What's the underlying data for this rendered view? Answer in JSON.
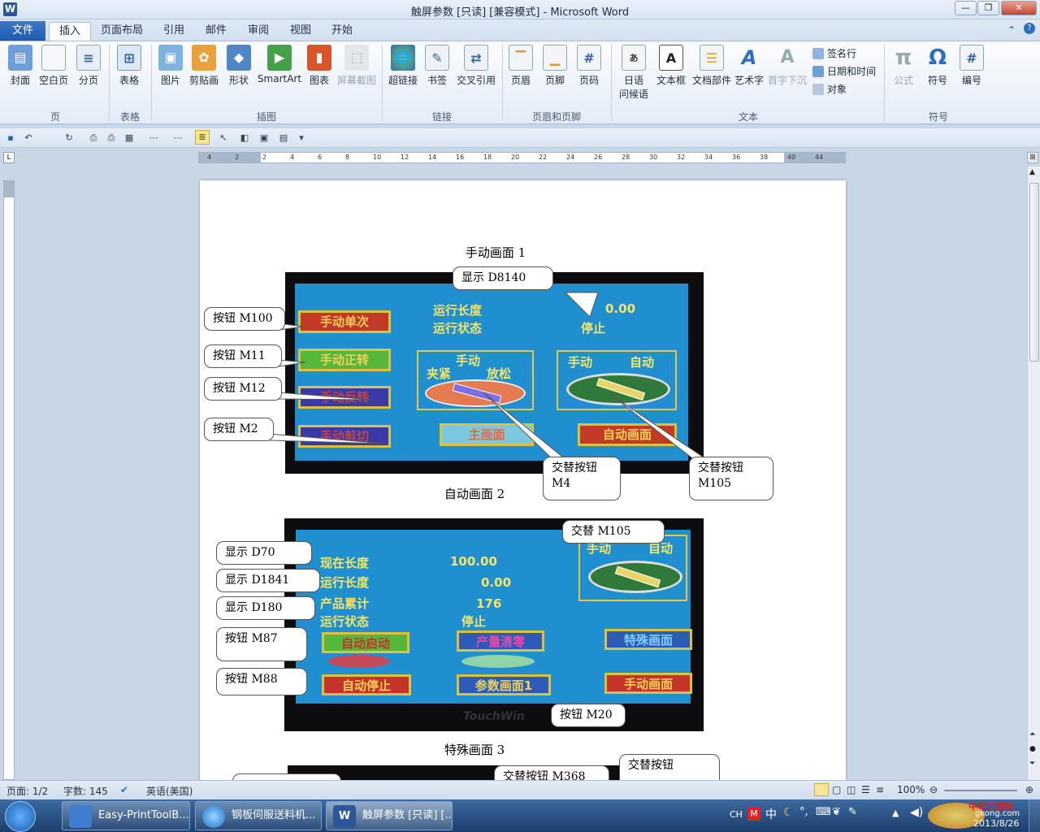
{
  "window": {
    "title": "触屏参数 [只读] [兼容模式] - Microsoft Word",
    "app_icon": "W"
  },
  "ribbon_tabs": [
    "文件",
    "插入",
    "页面布局",
    "引用",
    "邮件",
    "审阅",
    "视图",
    "开始"
  ],
  "ribbon": {
    "page_group": {
      "label": "页",
      "buttons": [
        "封面",
        "空白页",
        "分页"
      ]
    },
    "table_group": {
      "label": "表格",
      "buttons": [
        "表格"
      ]
    },
    "illustrations_group": {
      "label": "插图",
      "buttons": [
        "图片",
        "剪贴画",
        "形状",
        "SmartArt",
        "图表",
        "屏幕截图"
      ]
    },
    "links_group": {
      "label": "链接",
      "buttons": [
        "超链接",
        "书签",
        "交叉引用"
      ]
    },
    "header_footer_group": {
      "label": "页眉和页脚",
      "buttons": [
        "页眉",
        "页脚",
        "页码"
      ]
    },
    "text_group": {
      "label": "文本",
      "buttons": [
        "日语",
        "问候语",
        "文本框",
        "文档部件",
        "艺术字",
        "首字下沉"
      ],
      "small": [
        "签名行",
        "日期和时间",
        "对象"
      ]
    },
    "symbols_group": {
      "label": "符号",
      "buttons": [
        "公式",
        "符号",
        "编号"
      ]
    }
  },
  "ruler_marks": [
    "4",
    "2",
    "2",
    "4",
    "6",
    "8",
    "10",
    "12",
    "14",
    "16",
    "18",
    "20",
    "22",
    "24",
    "26",
    "28",
    "30",
    "32",
    "34",
    "36",
    "38",
    "40",
    "44"
  ],
  "document": {
    "caption1": "手动画面 1",
    "caption2": "自动画面 2",
    "caption3": "特殊画面 3",
    "hmi1": {
      "texts": [
        "运行长度",
        "0.00",
        "运行状态",
        "停止",
        "手动",
        "夹紧",
        "放松",
        "手动",
        "自动"
      ],
      "buttons": [
        "手动单次",
        "手动正转",
        "手动反转",
        "手动剪切",
        "主画面",
        "自动画面"
      ]
    },
    "hmi2": {
      "texts": [
        "现在长度",
        "100.00",
        "运行长度",
        "0.00",
        "产品累计",
        "176",
        "运行状态",
        "停止",
        "手动",
        "自动",
        "TouchWin"
      ],
      "buttons": [
        "自动启动",
        "产量清零",
        "特殊画面",
        "自动停止",
        "参数画面1",
        "手动画面"
      ]
    },
    "callouts1": [
      "显示 D8140",
      "按钮 M100",
      "按钮 M11",
      "按钮 M12",
      "按钮 M2",
      "交替按钮 M4",
      "交替按钮 M105"
    ],
    "callouts2": [
      "交替 M105",
      "显示 D70",
      "显示 D1841",
      "显示 D180",
      "按钮 M87",
      "按钮 M88",
      "按钮 M20"
    ],
    "callouts3": [
      "交替按钮 M368",
      "交替按钮"
    ]
  },
  "status": {
    "page": "页面: 1/2",
    "words": "字数: 145",
    "lang": "英语(美国)",
    "zoom": "100%"
  },
  "taskbar": {
    "items": [
      "Easy-PrintToolB...",
      "钢板伺服送料机...",
      "触屏参数 [只读] [..."
    ],
    "tray": {
      "ime": "CH",
      "date": "2013/8/26",
      "watermark": "中华工控网",
      "watermark_url": "gkong.com"
    }
  },
  "colors": {
    "hmi_blue": "#1f8fcf",
    "hmi_yellow": "#f4e46a",
    "ribbon_file": "#1f5ab0"
  }
}
